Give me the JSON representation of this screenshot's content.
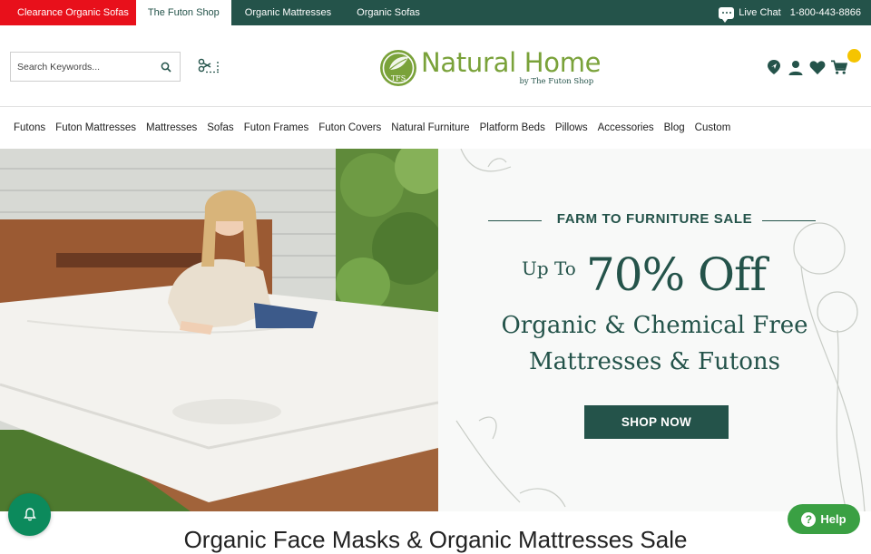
{
  "topbar": {
    "tabs": [
      {
        "label": "Clearance Organic Sofas"
      },
      {
        "label": "The Futon Shop"
      },
      {
        "label": "Organic Mattresses"
      },
      {
        "label": "Organic Sofas"
      }
    ],
    "live_chat": "Live Chat",
    "phone": "1-800-443-8866"
  },
  "header": {
    "search_placeholder": "Search Keywords...",
    "logo_title": "Natural Home",
    "logo_subtitle": "by The Futon Shop",
    "logo_mark": "TFS"
  },
  "nav": {
    "items": [
      {
        "label": "Futons"
      },
      {
        "label": "Futon Mattresses"
      },
      {
        "label": "Mattresses"
      },
      {
        "label": "Sofas"
      },
      {
        "label": "Futon Frames"
      },
      {
        "label": "Futon Covers"
      },
      {
        "label": "Natural Furniture"
      },
      {
        "label": "Platform Beds"
      },
      {
        "label": "Pillows"
      },
      {
        "label": "Accessories"
      },
      {
        "label": "Blog"
      },
      {
        "label": "Custom"
      }
    ]
  },
  "hero": {
    "kicker": "FARM TO FURNITURE SALE",
    "upto": "Up To",
    "big": "70% Off",
    "line1": "Organic & Chemical Free",
    "line2": "Mattresses & Futons",
    "cta": "SHOP NOW"
  },
  "section_title": "Organic Face Masks & Organic Mattresses Sale",
  "help_label": "Help",
  "colors": {
    "brand_dark": "#24534a",
    "brand_green": "#7aa23a",
    "clearance_red": "#e8101b",
    "cart_badge": "#f5c400",
    "help_green": "#3aa043",
    "bell_green": "#0c8a5c"
  },
  "icons": [
    "chat-icon",
    "search-icon",
    "scissors-icon",
    "location-icon",
    "account-icon",
    "heart-icon",
    "cart-icon",
    "bell-icon",
    "help-icon"
  ]
}
